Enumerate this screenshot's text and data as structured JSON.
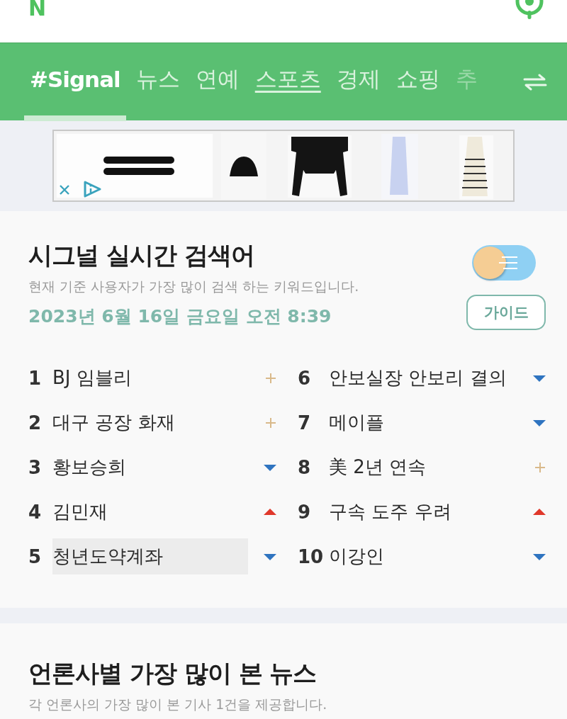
{
  "header": {
    "logo": "N"
  },
  "tabs": [
    {
      "label": "#Signal",
      "selected": true,
      "underlined": false,
      "faded": false
    },
    {
      "label": "뉴스",
      "selected": false,
      "underlined": false,
      "faded": false
    },
    {
      "label": "연예",
      "selected": false,
      "underlined": false,
      "faded": false
    },
    {
      "label": "스포츠",
      "selected": false,
      "underlined": true,
      "faded": false
    },
    {
      "label": "경제",
      "selected": false,
      "underlined": false,
      "faded": false
    },
    {
      "label": "쇼핑",
      "selected": false,
      "underlined": false,
      "faded": false
    },
    {
      "label": "추",
      "selected": false,
      "underlined": false,
      "faded": true
    }
  ],
  "realtime": {
    "title": "시그널 실시간 검색어",
    "subtitle": "현재 기준 사용자가 가장 많이 검색 하는 키워드입니다.",
    "datetime": "2023년 6월 16일 금요일 오전 8:39",
    "toggle_on": false,
    "guide_button": "가이드",
    "keywords": [
      {
        "rank": "1",
        "text": "BJ 임블리",
        "kind": "new",
        "selected": false
      },
      {
        "rank": "2",
        "text": "대구 공장 화재",
        "kind": "new",
        "selected": false
      },
      {
        "rank": "3",
        "text": "황보승희",
        "kind": "down",
        "selected": false
      },
      {
        "rank": "4",
        "text": "김민재",
        "kind": "up",
        "selected": false
      },
      {
        "rank": "5",
        "text": "청년도약계좌",
        "kind": "down",
        "selected": true
      },
      {
        "rank": "6",
        "text": "안보실장 안보리 결의",
        "kind": "down",
        "selected": false
      },
      {
        "rank": "7",
        "text": "메이플",
        "kind": "down",
        "selected": false
      },
      {
        "rank": "8",
        "text": "美 2년 연속",
        "kind": "new",
        "selected": false
      },
      {
        "rank": "9",
        "text": "구속 도주 우려",
        "kind": "up",
        "selected": false
      },
      {
        "rank": "10",
        "text": "이강인",
        "kind": "down",
        "selected": false
      }
    ]
  },
  "news": {
    "title": "언론사별 가장 많이 본 뉴스",
    "subtitle": "각 언론사의 가장 많이 본 기사 1건을 제공합니다."
  }
}
